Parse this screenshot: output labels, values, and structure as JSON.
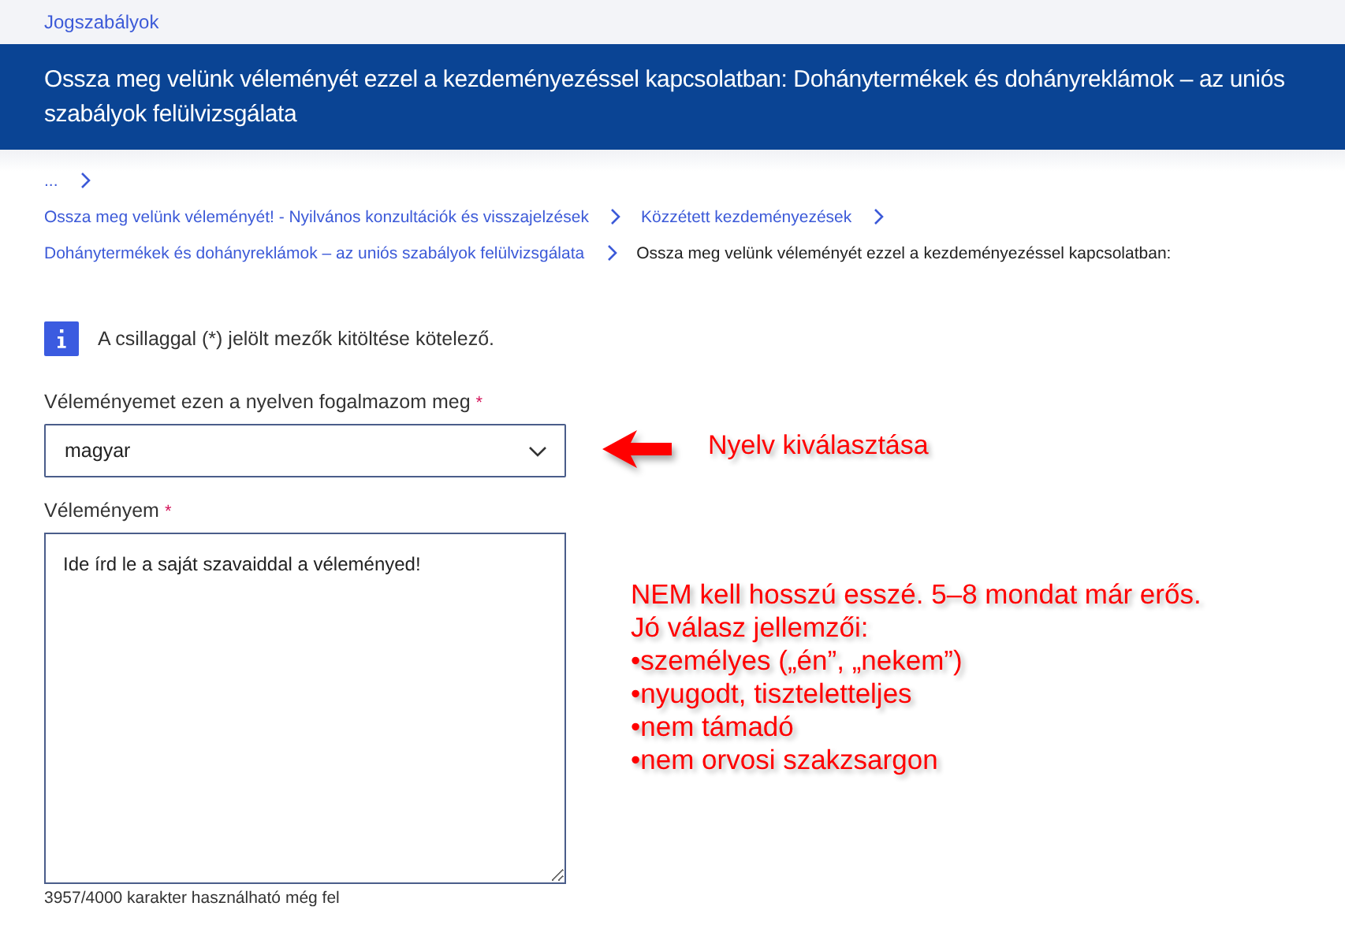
{
  "top_link": "Jogszabályok",
  "header": {
    "title": "Ossza meg velünk véleményét ezzel a kezdeményezéssel kapcsolatban: Dohánytermékek és dohányreklámok – az uniós szabályok felülvizsgálata"
  },
  "breadcrumbs": [
    [
      {
        "label": "...",
        "link": true
      }
    ],
    [
      {
        "label": "Ossza meg velünk véleményét! - Nyilvános konzultációk és visszajelzések",
        "link": true
      },
      {
        "label": "Közzétett kezdeményezések",
        "link": true
      }
    ],
    [
      {
        "label": "Dohánytermékek és dohányreklámok – az uniós szabályok felülvizsgálata",
        "link": true
      },
      {
        "label": "Ossza meg velünk véleményét ezzel a kezdeményezéssel kapcsolatban:",
        "link": false
      }
    ]
  ],
  "info": "A csillaggal (*) jelölt mezők kitöltése kötelező.",
  "language_field": {
    "label": "Véleményemet ezen a nyelven fogalmazom meg",
    "required_mark": "*",
    "value": "magyar"
  },
  "opinion_field": {
    "label": "Véleményem",
    "required_mark": "*",
    "value": "Ide írd le a saját szavaiddal a véleményed!",
    "counter": "3957/4000 karakter használható még fel"
  },
  "annotations": {
    "arrow_label": "Nyelv kiválasztása",
    "note_lines": [
      "NEM kell hosszú esszé. 5–8 mondat már erős.",
      "Jó válasz jellemzői:",
      "•személyes („én”, „nekem”)",
      "•nyugodt, tiszteletteljes",
      "•nem támadó",
      "•nem orvosi szakzsargon"
    ]
  }
}
